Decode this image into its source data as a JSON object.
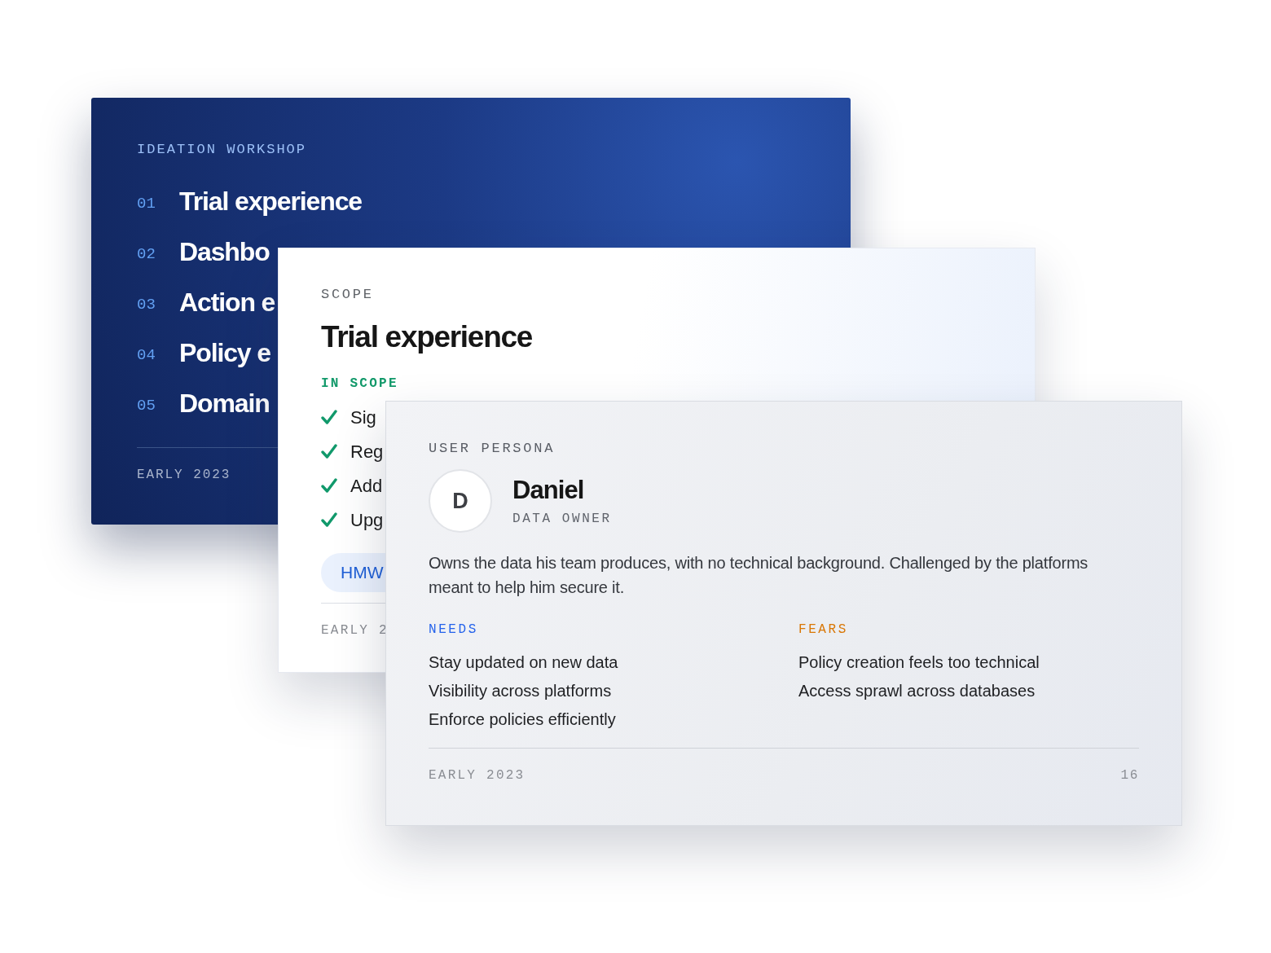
{
  "agenda_slide": {
    "eyebrow": "IDEATION WORKSHOP",
    "items": [
      {
        "number": "01",
        "title": "Trial experience"
      },
      {
        "number": "02",
        "title": "Dashbo"
      },
      {
        "number": "03",
        "title": "Action e"
      },
      {
        "number": "04",
        "title": "Policy e"
      },
      {
        "number": "05",
        "title": "Domain"
      }
    ],
    "footer": "EARLY 2023"
  },
  "scope_slide": {
    "eyebrow": "SCOPE",
    "title": "Trial experience",
    "section": "IN SCOPE",
    "items": [
      "Sig",
      "Reg",
      "Add",
      "Upg"
    ],
    "tag": "HMW",
    "footer": "EARLY 2"
  },
  "persona_slide": {
    "eyebrow": "USER PERSONA",
    "initial": "D",
    "name": "Daniel",
    "role": "DATA OWNER",
    "description": "Owns the data his team produces, with no technical background. Challenged by the platforms meant to help him secure it.",
    "columns": [
      {
        "heading": "NEEDS",
        "color": "#2563eb",
        "items": [
          "Stay updated on new data",
          "Visibility across platforms",
          "Enforce policies efficiently"
        ]
      },
      {
        "heading": "FEARS",
        "color": "#d97706",
        "items": [
          "Policy creation feels too technical",
          "Access sprawl across databases"
        ]
      }
    ],
    "footer": "EARLY 2023",
    "page": "16"
  }
}
